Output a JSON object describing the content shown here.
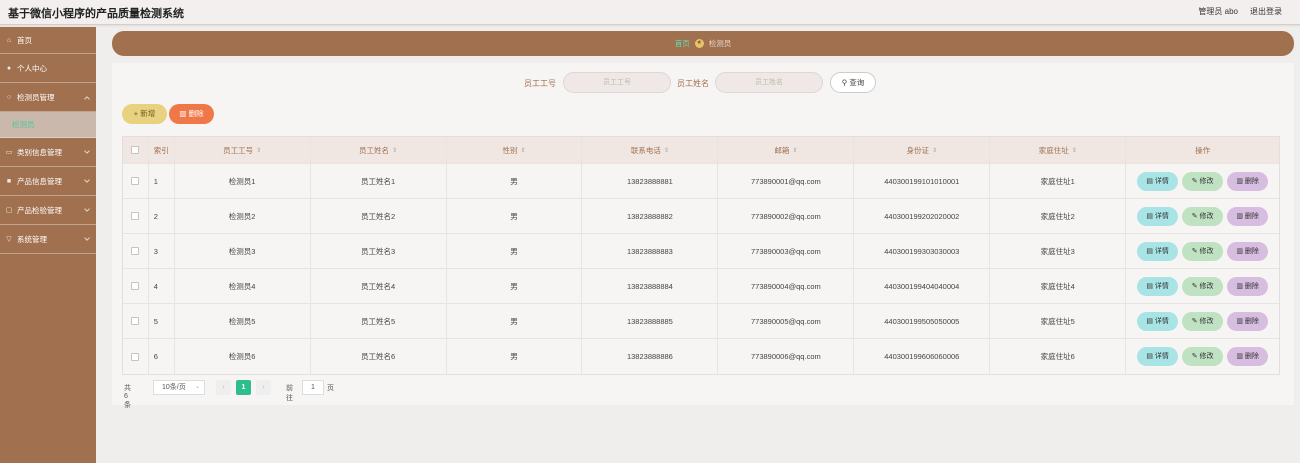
{
  "header": {
    "title": "基于微信小程序的产品质量检测系统",
    "user": "管理员 abo",
    "logout": "退出登录"
  },
  "sidebar": {
    "items": [
      {
        "label": "首页",
        "icon": "home-icon"
      },
      {
        "label": "个人中心",
        "icon": "person-icon"
      },
      {
        "label": "检测员管理",
        "icon": "user-group-icon",
        "sub": "检测员"
      },
      {
        "label": "类别信息管理",
        "icon": "folder-icon"
      },
      {
        "label": "产品信息管理",
        "icon": "box-icon"
      },
      {
        "label": "产品检验管理",
        "icon": "clipboard-icon"
      },
      {
        "label": "系统管理",
        "icon": "settings-icon"
      }
    ]
  },
  "breadcrumb": {
    "home": "首页",
    "current": "检测员"
  },
  "search": {
    "label1": "员工工号",
    "placeholder1": "员工工号",
    "label2": "员工姓名",
    "placeholder2": "员工姓名",
    "button": "查询"
  },
  "actions": {
    "add": "新增",
    "delete": "删除"
  },
  "table": {
    "headers": [
      "索引",
      "员工工号",
      "员工姓名",
      "性别",
      "联系电话",
      "邮箱",
      "身份证",
      "家庭住址",
      "操作"
    ],
    "rows": [
      [
        "1",
        "检测员1",
        "员工姓名1",
        "男",
        "13823888881",
        "773890001@qq.com",
        "440300199101010001",
        "家庭住址1"
      ],
      [
        "2",
        "检测员2",
        "员工姓名2",
        "男",
        "13823888882",
        "773890002@qq.com",
        "440300199202020002",
        "家庭住址2"
      ],
      [
        "3",
        "检测员3",
        "员工姓名3",
        "男",
        "13823888883",
        "773890003@qq.com",
        "440300199303030003",
        "家庭住址3"
      ],
      [
        "4",
        "检测员4",
        "员工姓名4",
        "男",
        "13823888884",
        "773890004@qq.com",
        "440300199404040004",
        "家庭住址4"
      ],
      [
        "5",
        "检测员5",
        "员工姓名5",
        "男",
        "13823888885",
        "773890005@qq.com",
        "440300199505050005",
        "家庭住址5"
      ],
      [
        "6",
        "检测员6",
        "员工姓名6",
        "男",
        "13823888886",
        "773890006@qq.com",
        "440300199606060006",
        "家庭住址6"
      ]
    ],
    "ops": {
      "view": "详情",
      "edit": "修改",
      "delete": "删除"
    }
  },
  "pagination": {
    "total": "共 6 条",
    "page_size": "10条/页",
    "current_page": "1",
    "goto_label": "前往",
    "goto_value": "1",
    "page_suffix": "页"
  },
  "colors": {
    "brand": "#a0704f",
    "accent": "#2ebd8f"
  }
}
